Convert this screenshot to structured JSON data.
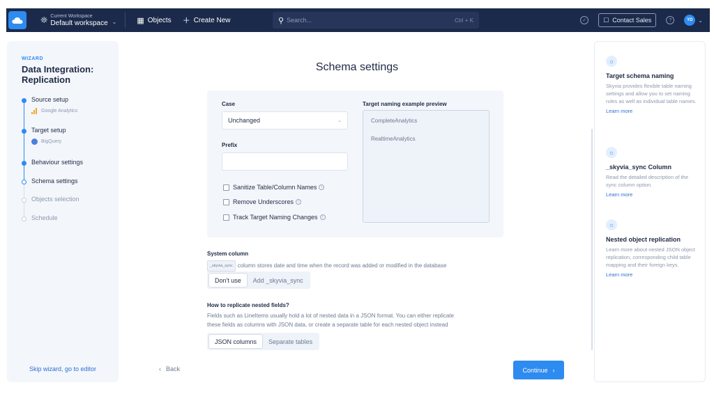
{
  "topbar": {
    "workspace_label": "Current Workspace",
    "workspace_value": "Default workspace",
    "objects": "Objects",
    "create_new": "Create New",
    "search_placeholder": "Search...",
    "search_shortcut": "Ctrl + K",
    "contact_sales": "Contact Sales",
    "avatar_initials": "YD"
  },
  "wizard": {
    "tag": "WIZARD",
    "title": "Data Integration: Replication",
    "steps": [
      {
        "label": "Source setup",
        "sub": "Google Analytics",
        "state": "done"
      },
      {
        "label": "Target setup",
        "sub": "BigQuery",
        "state": "done"
      },
      {
        "label": "Behaviour settings",
        "state": "done"
      },
      {
        "label": "Schema settings",
        "state": "current"
      },
      {
        "label": "Objects selection",
        "state": "todo"
      },
      {
        "label": "Schedule",
        "state": "todo"
      }
    ],
    "skip": "Skip wizard, go to editor"
  },
  "main": {
    "title": "Schema settings",
    "case_label": "Case",
    "case_value": "Unchanged",
    "prefix_label": "Prefix",
    "prefix_value": "",
    "checkboxes": [
      "Sanitize Table/Column Names",
      "Remove Underscores",
      "Track Target Naming Changes"
    ],
    "preview_label": "Target naming example preview",
    "preview_items": [
      "CompleteAnalytics",
      "RealtimeAnalytics"
    ],
    "system_column_title": "System column",
    "system_column_code": "_skyvia_sync",
    "system_column_text": "column stores date and time when the record was added or modified in the database",
    "system_options": [
      "Don't use",
      "Add _skyvia_sync"
    ],
    "nested_title": "How to replicate nested fields?",
    "nested_text_1": "Fields such as LineItems usually hold a lot of nested data in a JSON format. You can either replicate",
    "nested_text_2": "these fields as columns with JSON data, or create a separate table for each nested object instead",
    "nested_options": [
      "JSON columns",
      "Separate tables"
    ],
    "back": "Back",
    "continue": "Continue"
  },
  "help": [
    {
      "title": "Target schema naming",
      "text": "Skyvia provides flexible table naming settings and allow you to set naming rules as well as individual table names.",
      "link": "Learn more"
    },
    {
      "title": "_skyvia_sync Column",
      "text": "Read the detailed description of the sync column option.",
      "link": "Learn more"
    },
    {
      "title": "Nested object replication",
      "text": "Learn more about nested JSON object replication, corresponding child table mapping and their foreign keys.",
      "link": "Learn more"
    }
  ],
  "colors": {
    "nav": "#1b2a4a",
    "accent": "#2e8bf0",
    "panel": "#f3f6fb"
  }
}
